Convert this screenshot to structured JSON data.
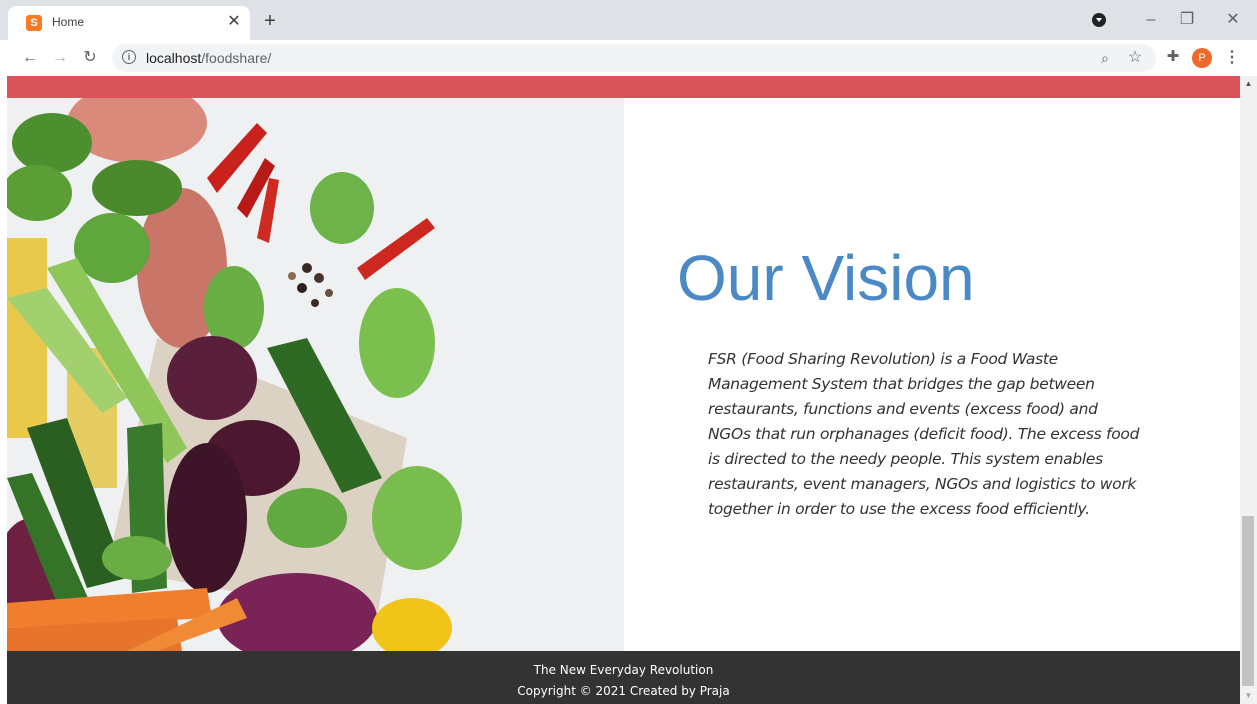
{
  "browser": {
    "tab_title": "Home",
    "new_tab_symbol": "+",
    "favicon_letter": "S",
    "url_host": "localhost",
    "url_path": "/foodshare/",
    "avatar_letter": "P",
    "icons": [
      "favicon-icon",
      "close-icon",
      "plus-icon",
      "media-icon",
      "minimize-icon",
      "restore-icon",
      "window-close-icon",
      "back-icon",
      "forward-icon",
      "reload-icon",
      "info-icon",
      "zoom-icon",
      "star-icon",
      "extensions-icon",
      "menu-icon"
    ]
  },
  "page": {
    "accent_color": "#d9535a",
    "title_color": "#4a89c6",
    "footer_color": "#333333",
    "vision_title": "Our Vision",
    "vision_text": "FSR (Food Sharing Revolution) is a Food Waste Management System that bridges the gap between restaurants, functions and events (excess food) and NGOs that run orphanages (deficit food). The excess food is directed to the needy people. This system enables restaurants, event managers, NGOs and logistics to work together in order to use the excess food efficiently.",
    "footer_line1": "The New Everyday Revolution",
    "footer_line2": "Copyright © 2021 Created by Praja"
  }
}
